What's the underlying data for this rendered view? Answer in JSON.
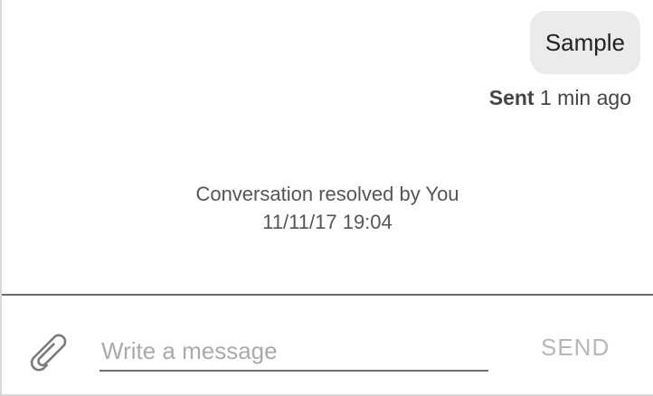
{
  "messages": [
    {
      "text": "Sample",
      "status": "Sent",
      "time": "1 min ago"
    }
  ],
  "system_message": {
    "line1": "Conversation resolved by You",
    "line2": "11/11/17 19:04"
  },
  "composer": {
    "attach_icon": "paperclip-icon",
    "placeholder": "Write a message",
    "value": "",
    "send_label": "SEND"
  },
  "colors": {
    "bubble_bg": "#ebebeb",
    "divider": "#6a6a6a",
    "send_disabled": "#b8b8b8",
    "placeholder": "#aaaaaa"
  }
}
